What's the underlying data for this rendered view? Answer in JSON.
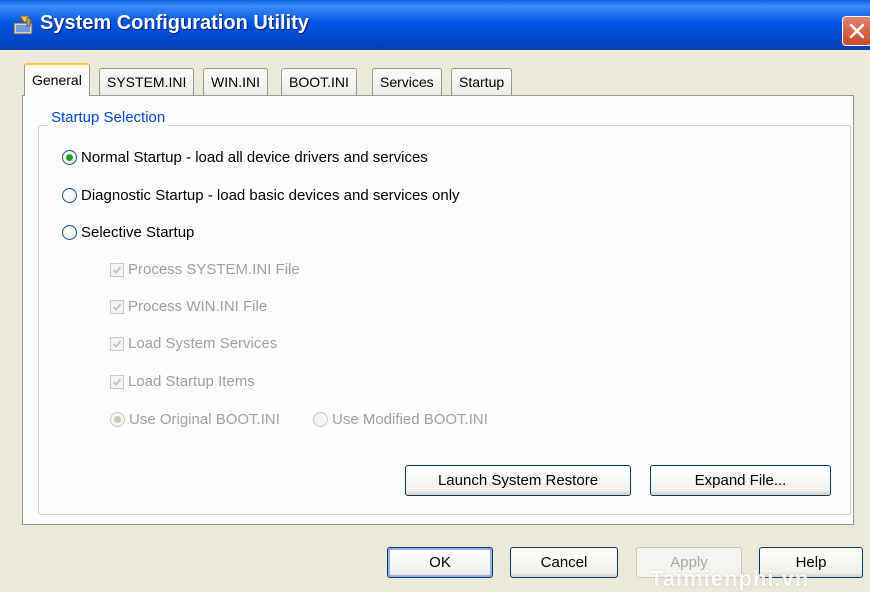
{
  "window": {
    "title": "System Configuration Utility",
    "icon": "system-config-icon",
    "close_icon": "close-icon"
  },
  "tabs": [
    {
      "label": "General",
      "active": true
    },
    {
      "label": "SYSTEM.INI",
      "active": false
    },
    {
      "label": "WIN.INI",
      "active": false
    },
    {
      "label": "BOOT.INI",
      "active": false
    },
    {
      "label": "Services",
      "active": false
    },
    {
      "label": "Startup",
      "active": false
    }
  ],
  "startup_selection": {
    "label": "Startup Selection",
    "options": [
      {
        "label": "Normal Startup - load all device drivers and services",
        "selected": true
      },
      {
        "label": "Diagnostic Startup - load basic devices and services only",
        "selected": false
      },
      {
        "label": "Selective Startup",
        "selected": false
      }
    ],
    "selective": {
      "checkboxes": [
        {
          "label": "Process SYSTEM.INI File",
          "checked": true,
          "enabled": false
        },
        {
          "label": "Process WIN.INI File",
          "checked": true,
          "enabled": false
        },
        {
          "label": "Load System Services",
          "checked": true,
          "enabled": false
        },
        {
          "label": "Load Startup Items",
          "checked": true,
          "enabled": false
        }
      ],
      "boot_options": [
        {
          "label": "Use Original BOOT.INI",
          "selected": true,
          "enabled": false
        },
        {
          "label": "Use Modified BOOT.INI",
          "selected": false,
          "enabled": false
        }
      ]
    },
    "launch_restore_label": "Launch System Restore",
    "expand_file_label": "Expand File..."
  },
  "footer": {
    "ok_label": "OK",
    "cancel_label": "Cancel",
    "apply_label": "Apply",
    "help_label": "Help"
  },
  "watermark": "Taimienphi.vn",
  "colors": {
    "title_bar": "#0055e5",
    "group_label": "#0046d5",
    "active_tab_highlight": "#ffc83c",
    "radio_selected": "#21a121",
    "disabled_text": "#a2a191"
  }
}
